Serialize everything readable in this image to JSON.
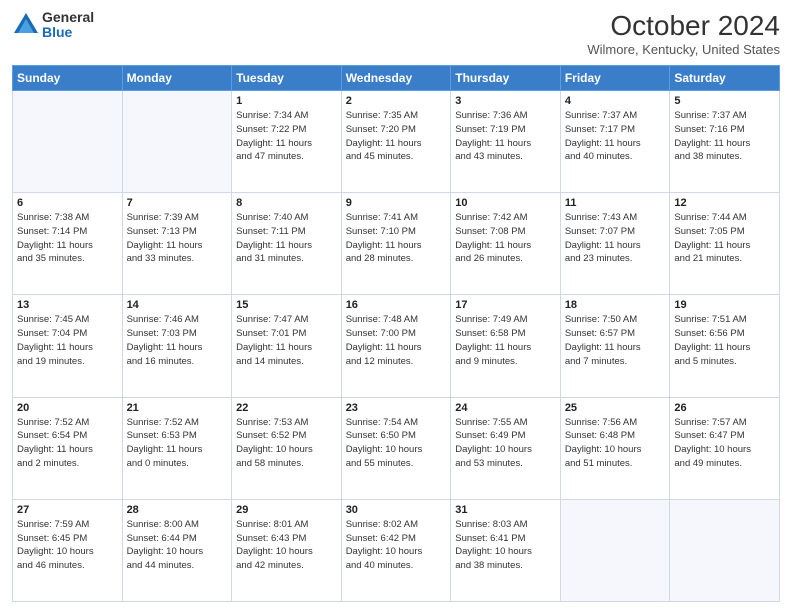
{
  "header": {
    "logo_general": "General",
    "logo_blue": "Blue",
    "title": "October 2024",
    "location": "Wilmore, Kentucky, United States"
  },
  "days_of_week": [
    "Sunday",
    "Monday",
    "Tuesday",
    "Wednesday",
    "Thursday",
    "Friday",
    "Saturday"
  ],
  "weeks": [
    [
      {
        "day": "",
        "empty": true
      },
      {
        "day": "",
        "empty": true
      },
      {
        "day": "1",
        "lines": [
          "Sunrise: 7:34 AM",
          "Sunset: 7:22 PM",
          "Daylight: 11 hours",
          "and 47 minutes."
        ]
      },
      {
        "day": "2",
        "lines": [
          "Sunrise: 7:35 AM",
          "Sunset: 7:20 PM",
          "Daylight: 11 hours",
          "and 45 minutes."
        ]
      },
      {
        "day": "3",
        "lines": [
          "Sunrise: 7:36 AM",
          "Sunset: 7:19 PM",
          "Daylight: 11 hours",
          "and 43 minutes."
        ]
      },
      {
        "day": "4",
        "lines": [
          "Sunrise: 7:37 AM",
          "Sunset: 7:17 PM",
          "Daylight: 11 hours",
          "and 40 minutes."
        ]
      },
      {
        "day": "5",
        "lines": [
          "Sunrise: 7:37 AM",
          "Sunset: 7:16 PM",
          "Daylight: 11 hours",
          "and 38 minutes."
        ]
      }
    ],
    [
      {
        "day": "6",
        "lines": [
          "Sunrise: 7:38 AM",
          "Sunset: 7:14 PM",
          "Daylight: 11 hours",
          "and 35 minutes."
        ]
      },
      {
        "day": "7",
        "lines": [
          "Sunrise: 7:39 AM",
          "Sunset: 7:13 PM",
          "Daylight: 11 hours",
          "and 33 minutes."
        ]
      },
      {
        "day": "8",
        "lines": [
          "Sunrise: 7:40 AM",
          "Sunset: 7:11 PM",
          "Daylight: 11 hours",
          "and 31 minutes."
        ]
      },
      {
        "day": "9",
        "lines": [
          "Sunrise: 7:41 AM",
          "Sunset: 7:10 PM",
          "Daylight: 11 hours",
          "and 28 minutes."
        ]
      },
      {
        "day": "10",
        "lines": [
          "Sunrise: 7:42 AM",
          "Sunset: 7:08 PM",
          "Daylight: 11 hours",
          "and 26 minutes."
        ]
      },
      {
        "day": "11",
        "lines": [
          "Sunrise: 7:43 AM",
          "Sunset: 7:07 PM",
          "Daylight: 11 hours",
          "and 23 minutes."
        ]
      },
      {
        "day": "12",
        "lines": [
          "Sunrise: 7:44 AM",
          "Sunset: 7:05 PM",
          "Daylight: 11 hours",
          "and 21 minutes."
        ]
      }
    ],
    [
      {
        "day": "13",
        "lines": [
          "Sunrise: 7:45 AM",
          "Sunset: 7:04 PM",
          "Daylight: 11 hours",
          "and 19 minutes."
        ]
      },
      {
        "day": "14",
        "lines": [
          "Sunrise: 7:46 AM",
          "Sunset: 7:03 PM",
          "Daylight: 11 hours",
          "and 16 minutes."
        ]
      },
      {
        "day": "15",
        "lines": [
          "Sunrise: 7:47 AM",
          "Sunset: 7:01 PM",
          "Daylight: 11 hours",
          "and 14 minutes."
        ]
      },
      {
        "day": "16",
        "lines": [
          "Sunrise: 7:48 AM",
          "Sunset: 7:00 PM",
          "Daylight: 11 hours",
          "and 12 minutes."
        ]
      },
      {
        "day": "17",
        "lines": [
          "Sunrise: 7:49 AM",
          "Sunset: 6:58 PM",
          "Daylight: 11 hours",
          "and 9 minutes."
        ]
      },
      {
        "day": "18",
        "lines": [
          "Sunrise: 7:50 AM",
          "Sunset: 6:57 PM",
          "Daylight: 11 hours",
          "and 7 minutes."
        ]
      },
      {
        "day": "19",
        "lines": [
          "Sunrise: 7:51 AM",
          "Sunset: 6:56 PM",
          "Daylight: 11 hours",
          "and 5 minutes."
        ]
      }
    ],
    [
      {
        "day": "20",
        "lines": [
          "Sunrise: 7:52 AM",
          "Sunset: 6:54 PM",
          "Daylight: 11 hours",
          "and 2 minutes."
        ]
      },
      {
        "day": "21",
        "lines": [
          "Sunrise: 7:52 AM",
          "Sunset: 6:53 PM",
          "Daylight: 11 hours",
          "and 0 minutes."
        ]
      },
      {
        "day": "22",
        "lines": [
          "Sunrise: 7:53 AM",
          "Sunset: 6:52 PM",
          "Daylight: 10 hours",
          "and 58 minutes."
        ]
      },
      {
        "day": "23",
        "lines": [
          "Sunrise: 7:54 AM",
          "Sunset: 6:50 PM",
          "Daylight: 10 hours",
          "and 55 minutes."
        ]
      },
      {
        "day": "24",
        "lines": [
          "Sunrise: 7:55 AM",
          "Sunset: 6:49 PM",
          "Daylight: 10 hours",
          "and 53 minutes."
        ]
      },
      {
        "day": "25",
        "lines": [
          "Sunrise: 7:56 AM",
          "Sunset: 6:48 PM",
          "Daylight: 10 hours",
          "and 51 minutes."
        ]
      },
      {
        "day": "26",
        "lines": [
          "Sunrise: 7:57 AM",
          "Sunset: 6:47 PM",
          "Daylight: 10 hours",
          "and 49 minutes."
        ]
      }
    ],
    [
      {
        "day": "27",
        "lines": [
          "Sunrise: 7:59 AM",
          "Sunset: 6:45 PM",
          "Daylight: 10 hours",
          "and 46 minutes."
        ]
      },
      {
        "day": "28",
        "lines": [
          "Sunrise: 8:00 AM",
          "Sunset: 6:44 PM",
          "Daylight: 10 hours",
          "and 44 minutes."
        ]
      },
      {
        "day": "29",
        "lines": [
          "Sunrise: 8:01 AM",
          "Sunset: 6:43 PM",
          "Daylight: 10 hours",
          "and 42 minutes."
        ]
      },
      {
        "day": "30",
        "lines": [
          "Sunrise: 8:02 AM",
          "Sunset: 6:42 PM",
          "Daylight: 10 hours",
          "and 40 minutes."
        ]
      },
      {
        "day": "31",
        "lines": [
          "Sunrise: 8:03 AM",
          "Sunset: 6:41 PM",
          "Daylight: 10 hours",
          "and 38 minutes."
        ]
      },
      {
        "day": "",
        "empty": true
      },
      {
        "day": "",
        "empty": true
      }
    ]
  ]
}
